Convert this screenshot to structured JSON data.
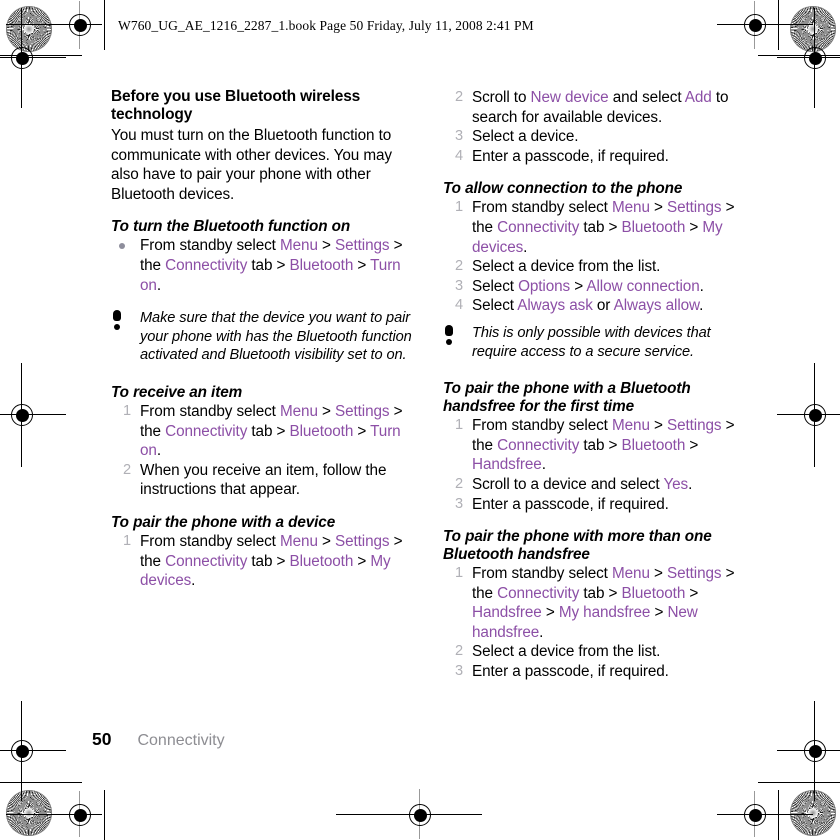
{
  "header": {
    "text": "W760_UG_AE_1216_2287_1.book  Page 50  Friday, July 11, 2008  2:41 PM"
  },
  "footer": {
    "page_number": "50",
    "chapter": "Connectivity"
  },
  "colors": {
    "link": "#8c4fa6",
    "step_number": "#b0b0b6",
    "bullet": "#8e8e9c",
    "chapter_text": "#8d8d92",
    "body_text": "#000000"
  },
  "left_column": {
    "section_title": "Before you use Bluetooth wireless technology",
    "intro_paragraph": "You must turn on the Bluetooth function to communicate with other devices. You may also have to pair your phone with other Bluetooth devices.",
    "proc_turn_on": {
      "title": "To turn the Bluetooth function on",
      "bullet_step": {
        "marker": "bullet",
        "parts": [
          {
            "text": "From standby select ",
            "style": "plain"
          },
          {
            "text": "Menu",
            "style": "link"
          },
          {
            "text": " > ",
            "style": "plain"
          },
          {
            "text": "Settings",
            "style": "link"
          },
          {
            "text": " > the ",
            "style": "plain"
          },
          {
            "text": "Connectivity",
            "style": "link"
          },
          {
            "text": " tab > ",
            "style": "plain"
          },
          {
            "text": "Bluetooth",
            "style": "link"
          },
          {
            "text": " > ",
            "style": "plain"
          },
          {
            "text": "Turn on",
            "style": "link"
          },
          {
            "text": ".",
            "style": "plain"
          }
        ]
      }
    },
    "note": "Make sure that the device you want to pair your phone with has the Bluetooth function activated and Bluetooth visibility set to on.",
    "proc_receive": {
      "title": "To receive an item",
      "steps": [
        {
          "marker": "1",
          "parts": [
            {
              "text": "From standby select ",
              "style": "plain"
            },
            {
              "text": "Menu",
              "style": "link"
            },
            {
              "text": " > ",
              "style": "plain"
            },
            {
              "text": "Settings",
              "style": "link"
            },
            {
              "text": " > the ",
              "style": "plain"
            },
            {
              "text": "Connectivity",
              "style": "link"
            },
            {
              "text": " tab > ",
              "style": "plain"
            },
            {
              "text": "Bluetooth",
              "style": "link"
            },
            {
              "text": " > ",
              "style": "plain"
            },
            {
              "text": "Turn on",
              "style": "link"
            },
            {
              "text": ".",
              "style": "plain"
            }
          ]
        },
        {
          "marker": "2",
          "parts": [
            {
              "text": "When you receive an item, follow the instructions that appear.",
              "style": "plain"
            }
          ]
        }
      ]
    },
    "proc_pair_device": {
      "title": "To pair the phone with a device",
      "steps": [
        {
          "marker": "1",
          "parts": [
            {
              "text": "From standby select ",
              "style": "plain"
            },
            {
              "text": "Menu",
              "style": "link"
            },
            {
              "text": " > ",
              "style": "plain"
            },
            {
              "text": "Settings",
              "style": "link"
            },
            {
              "text": " > the ",
              "style": "plain"
            },
            {
              "text": "Connectivity",
              "style": "link"
            },
            {
              "text": " tab > ",
              "style": "plain"
            },
            {
              "text": "Bluetooth",
              "style": "link"
            },
            {
              "text": " > ",
              "style": "plain"
            },
            {
              "text": "My devices",
              "style": "link"
            },
            {
              "text": ".",
              "style": "plain"
            }
          ]
        }
      ]
    }
  },
  "right_column": {
    "proc_pair_device_cont": {
      "steps": [
        {
          "marker": "2",
          "parts": [
            {
              "text": "Scroll to ",
              "style": "plain"
            },
            {
              "text": "New device",
              "style": "link"
            },
            {
              "text": " and select ",
              "style": "plain"
            },
            {
              "text": "Add",
              "style": "link"
            },
            {
              "text": " to search for available devices.",
              "style": "plain"
            }
          ]
        },
        {
          "marker": "3",
          "parts": [
            {
              "text": "Select a device.",
              "style": "plain"
            }
          ]
        },
        {
          "marker": "4",
          "parts": [
            {
              "text": "Enter a passcode, if required.",
              "style": "plain"
            }
          ]
        }
      ]
    },
    "proc_allow_connection": {
      "title": "To allow connection to the phone",
      "steps": [
        {
          "marker": "1",
          "parts": [
            {
              "text": "From standby select ",
              "style": "plain"
            },
            {
              "text": "Menu",
              "style": "link"
            },
            {
              "text": " > ",
              "style": "plain"
            },
            {
              "text": "Settings",
              "style": "link"
            },
            {
              "text": " > the ",
              "style": "plain"
            },
            {
              "text": "Connectivity",
              "style": "link"
            },
            {
              "text": " tab > ",
              "style": "plain"
            },
            {
              "text": "Bluetooth",
              "style": "link"
            },
            {
              "text": " > ",
              "style": "plain"
            },
            {
              "text": "My devices",
              "style": "link"
            },
            {
              "text": ".",
              "style": "plain"
            }
          ]
        },
        {
          "marker": "2",
          "parts": [
            {
              "text": "Select a device from the list.",
              "style": "plain"
            }
          ]
        },
        {
          "marker": "3",
          "parts": [
            {
              "text": "Select ",
              "style": "plain"
            },
            {
              "text": "Options",
              "style": "link"
            },
            {
              "text": " > ",
              "style": "plain"
            },
            {
              "text": "Allow connection",
              "style": "link"
            },
            {
              "text": ".",
              "style": "plain"
            }
          ]
        },
        {
          "marker": "4",
          "parts": [
            {
              "text": "Select ",
              "style": "plain"
            },
            {
              "text": "Always ask",
              "style": "link"
            },
            {
              "text": " or ",
              "style": "plain"
            },
            {
              "text": "Always allow",
              "style": "link"
            },
            {
              "text": ".",
              "style": "plain"
            }
          ]
        }
      ]
    },
    "note": "This is only possible with devices that require access to a secure service.",
    "proc_pair_handsfree": {
      "title": "To pair the phone with a Bluetooth handsfree for the first time",
      "steps": [
        {
          "marker": "1",
          "parts": [
            {
              "text": "From standby select ",
              "style": "plain"
            },
            {
              "text": "Menu",
              "style": "link"
            },
            {
              "text": " > ",
              "style": "plain"
            },
            {
              "text": "Settings",
              "style": "link"
            },
            {
              "text": " > the ",
              "style": "plain"
            },
            {
              "text": "Connectivity",
              "style": "link"
            },
            {
              "text": " tab > ",
              "style": "plain"
            },
            {
              "text": "Bluetooth",
              "style": "link"
            },
            {
              "text": " > ",
              "style": "plain"
            },
            {
              "text": "Handsfree",
              "style": "link"
            },
            {
              "text": ".",
              "style": "plain"
            }
          ]
        },
        {
          "marker": "2",
          "parts": [
            {
              "text": "Scroll to a device and select ",
              "style": "plain"
            },
            {
              "text": "Yes",
              "style": "link"
            },
            {
              "text": ".",
              "style": "plain"
            }
          ]
        },
        {
          "marker": "3",
          "parts": [
            {
              "text": "Enter a passcode, if required.",
              "style": "plain"
            }
          ]
        }
      ]
    },
    "proc_pair_multi_handsfree": {
      "title": "To pair the phone with more than one Bluetooth handsfree",
      "steps": [
        {
          "marker": "1",
          "parts": [
            {
              "text": "From standby select ",
              "style": "plain"
            },
            {
              "text": "Menu",
              "style": "link"
            },
            {
              "text": " > ",
              "style": "plain"
            },
            {
              "text": "Settings",
              "style": "link"
            },
            {
              "text": " > the ",
              "style": "plain"
            },
            {
              "text": "Connectivity",
              "style": "link"
            },
            {
              "text": " tab > ",
              "style": "plain"
            },
            {
              "text": "Bluetooth",
              "style": "link"
            },
            {
              "text": " > ",
              "style": "plain"
            },
            {
              "text": "Handsfree",
              "style": "link"
            },
            {
              "text": " > ",
              "style": "plain"
            },
            {
              "text": "My handsfree",
              "style": "link"
            },
            {
              "text": " > ",
              "style": "plain"
            },
            {
              "text": "New handsfree",
              "style": "link"
            },
            {
              "text": ".",
              "style": "plain"
            }
          ]
        },
        {
          "marker": "2",
          "parts": [
            {
              "text": "Select a device from the list.",
              "style": "plain"
            }
          ]
        },
        {
          "marker": "3",
          "parts": [
            {
              "text": "Enter a passcode, if required.",
              "style": "plain"
            }
          ]
        }
      ]
    }
  }
}
